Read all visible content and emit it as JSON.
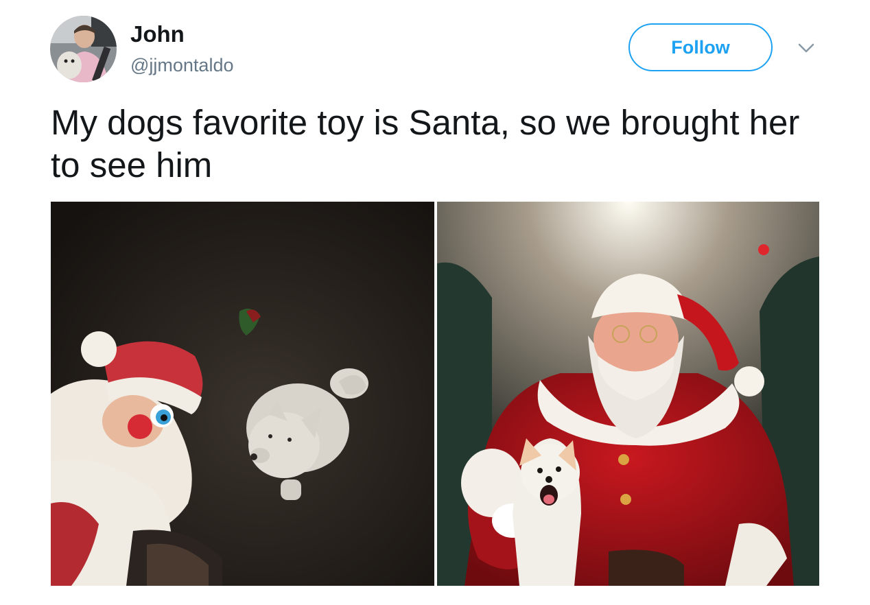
{
  "user": {
    "display_name": "John",
    "handle": "@jjmontaldo",
    "avatar": "profile-photo"
  },
  "follow_button": {
    "label": "Follow"
  },
  "menu": {
    "icon": "chevron-down-icon"
  },
  "tweet": {
    "text": "My dogs favorite toy is Santa, so we brought her to see him"
  },
  "media": {
    "photos": [
      {
        "description_icon": "photo-dog-with-santa-toy"
      },
      {
        "description_icon": "photo-dog-with-santa"
      }
    ]
  },
  "colors": {
    "accent": "#1da1f2",
    "text": "#14171a",
    "secondary": "#657786"
  }
}
